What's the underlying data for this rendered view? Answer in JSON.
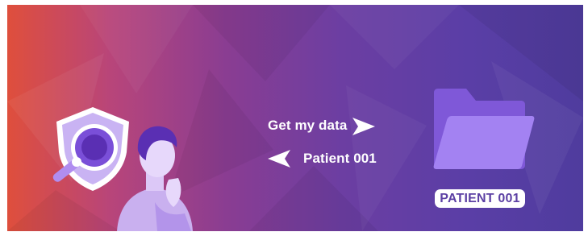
{
  "flow": {
    "request_label": "Get my data",
    "response_label": "Patient 001"
  },
  "folder": {
    "badge_label": "PATIENT 001"
  },
  "colors": {
    "gradient_start": "#df4f3c",
    "gradient_end": "#4f3c9e",
    "accent_purple": "#a382f2",
    "text": "#ffffff"
  },
  "icons": [
    "magnifier-shield-icon",
    "thinking-person-illustration",
    "right-arrow-icon",
    "left-arrow-icon",
    "folder-icon"
  ]
}
